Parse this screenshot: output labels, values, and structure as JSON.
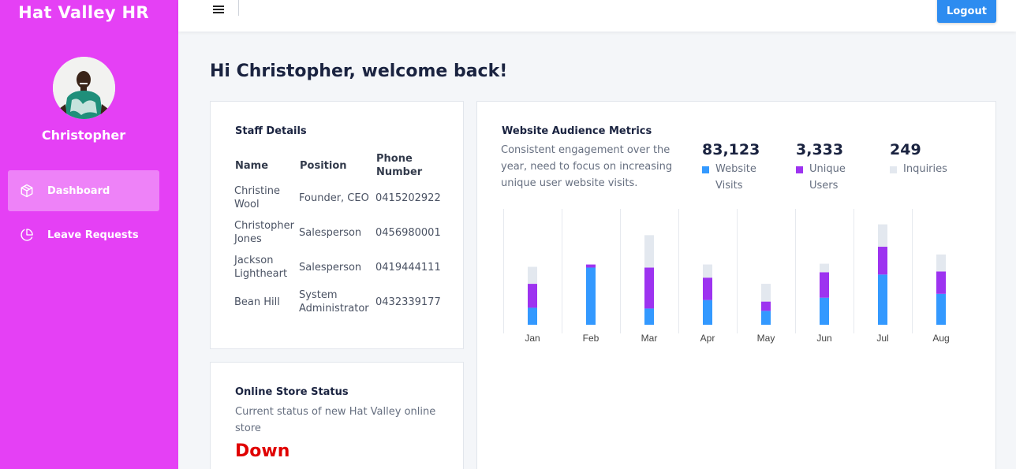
{
  "app": {
    "brand": "Hat Valley HR"
  },
  "user": {
    "name": "Christopher"
  },
  "sidebar": {
    "items": [
      {
        "label": "Dashboard",
        "icon": "cube-icon",
        "active": true
      },
      {
        "label": "Leave Requests",
        "icon": "pie-chart-icon",
        "active": false
      }
    ]
  },
  "topbar": {
    "menu_icon": "hamburger-menu-icon",
    "logout_label": "Logout"
  },
  "main": {
    "welcome": "Hi Christopher, welcome back!"
  },
  "staff": {
    "title": "Staff Details",
    "headers": [
      "Name",
      "Position",
      "Phone Number"
    ],
    "rows": [
      [
        "Christine Wool",
        "Founder, CEO",
        "0415202922"
      ],
      [
        "Christopher Jones",
        "Salesperson",
        "0456980001"
      ],
      [
        "Jackson Lightheart",
        "Salesperson",
        "0419444111"
      ],
      [
        "Bean Hill",
        "System Administrator",
        "0432339177"
      ]
    ]
  },
  "store": {
    "title": "Online Store Status",
    "description": "Current status of new Hat Valley online store",
    "status": "Down"
  },
  "metrics": {
    "title": "Website Audience Metrics",
    "description": "Consistent engagement over the year, need to focus on increasing unique user website visits.",
    "stats": [
      {
        "value": "83,123",
        "label": "Website Visits",
        "color": "#3399ff"
      },
      {
        "value": "3,333",
        "label": "Unique Users",
        "color": "#9d33f0"
      },
      {
        "value": "249",
        "label": "Inquiries",
        "color": "#e3e8ef"
      }
    ]
  },
  "colors": {
    "sidebar": "#e540f5",
    "accent": "#2d8cf0",
    "status_down": "#e00000"
  },
  "chart_data": {
    "type": "bar",
    "stacked": true,
    "categories": [
      "Jan",
      "Feb",
      "Mar",
      "Apr",
      "May",
      "Jun",
      "Jul",
      "Aug"
    ],
    "series": [
      {
        "name": "Website Visits",
        "color": "#3399ff",
        "values": [
          22,
          74,
          21,
          32,
          18,
          35,
          65,
          40
        ]
      },
      {
        "name": "Unique Users",
        "color": "#9d33f0",
        "values": [
          31,
          4,
          53,
          29,
          12,
          33,
          36,
          29
        ]
      },
      {
        "name": "Inquiries",
        "color": "#e3e8ef",
        "values": [
          22,
          0,
          42,
          17,
          23,
          11,
          29,
          22
        ]
      }
    ],
    "ylim": [
      0,
      150
    ],
    "grid": "vertical"
  }
}
